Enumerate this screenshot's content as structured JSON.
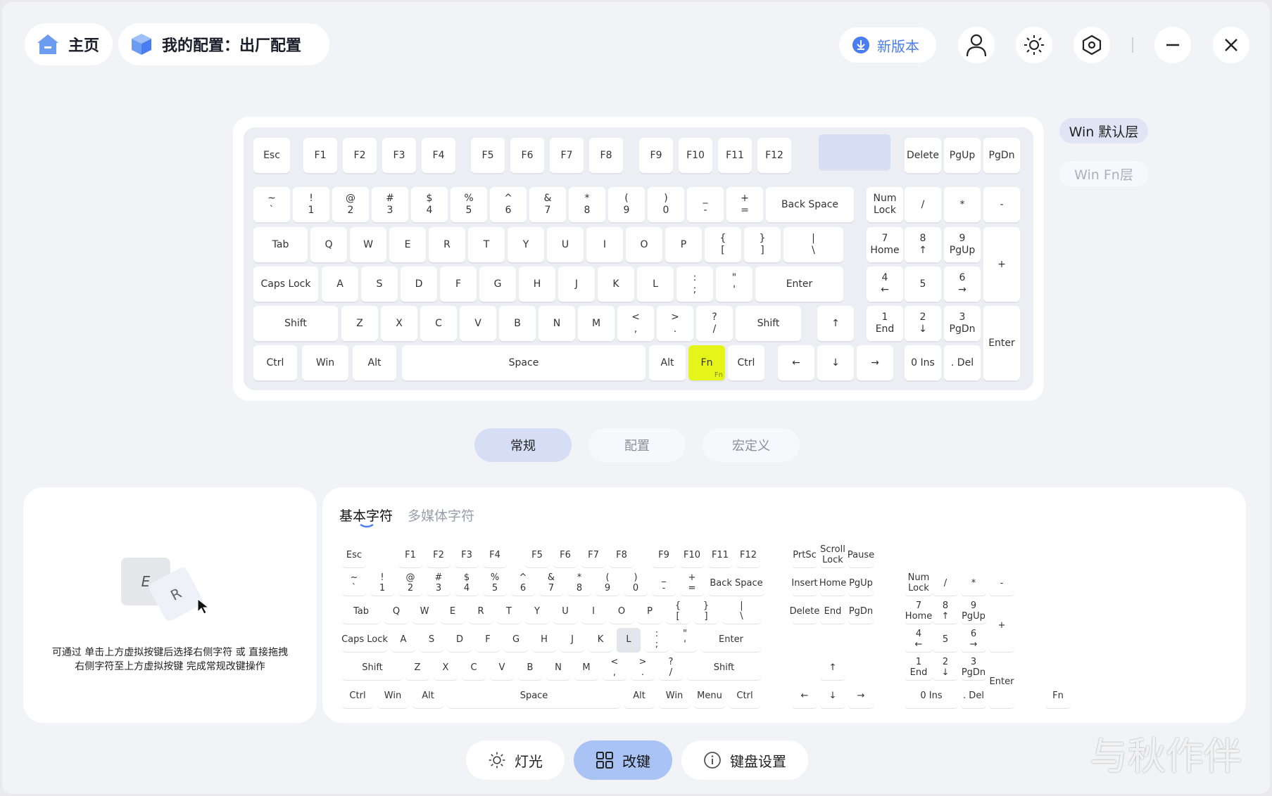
{
  "header": {
    "home_label": "主页",
    "config_label": "我的配置：出厂配置",
    "new_version_label": "新版本"
  },
  "layers": [
    "Win 默认层",
    "Win Fn层"
  ],
  "mode_tabs": [
    "常规",
    "配置",
    "宏定义"
  ],
  "left_panel": {
    "demo_key_1": "E",
    "demo_key_2": "R",
    "hint_line1": "可通过 单击上方虚拟按键后选择右侧字符 或 直接拖拽",
    "hint_line2": "右侧字符至上方虚拟按键 完成常规改键操作"
  },
  "char_tabs": [
    "基本字符",
    "多媒体字符"
  ],
  "bottom_tabs": [
    "灯光",
    "改键",
    "键盘设置"
  ],
  "watermark": "与秋作伴",
  "colors": {
    "accent": "#4a7df0",
    "selected_key": "#e5f51a",
    "active_tab_bg": "#d5def4"
  },
  "keyboard": [
    [
      "Esc"
    ],
    [
      "F1"
    ],
    [
      "F2"
    ],
    [
      "F3"
    ],
    [
      "F4"
    ],
    [
      "F5"
    ],
    [
      "F6"
    ],
    [
      "F7"
    ],
    [
      "F8"
    ],
    [
      "F9"
    ],
    [
      "F10"
    ],
    [
      "F11"
    ],
    [
      "F12"
    ],
    [
      ""
    ],
    [
      "Delete"
    ],
    [
      "PgUp"
    ],
    [
      "PgDn"
    ],
    [
      "~",
      "`"
    ],
    [
      "!",
      "1"
    ],
    [
      "@",
      "2"
    ],
    [
      "#",
      "3"
    ],
    [
      "$",
      "4"
    ],
    [
      "%",
      "5"
    ],
    [
      "^",
      "6"
    ],
    [
      "&",
      "7"
    ],
    [
      "*",
      "8"
    ],
    [
      "(",
      "9"
    ],
    [
      ")",
      "0"
    ],
    [
      "_",
      "-"
    ],
    [
      "+",
      "="
    ],
    [
      "Back Space"
    ],
    [
      "Num",
      "Lock"
    ],
    [
      "/"
    ],
    [
      "*"
    ],
    [
      "-"
    ],
    [
      "Tab"
    ],
    [
      "Q"
    ],
    [
      "W"
    ],
    [
      "E"
    ],
    [
      "R"
    ],
    [
      "T"
    ],
    [
      "Y"
    ],
    [
      "U"
    ],
    [
      "I"
    ],
    [
      "O"
    ],
    [
      "P"
    ],
    [
      "{",
      "["
    ],
    [
      "}",
      "]"
    ],
    [
      "|",
      "\\"
    ],
    [
      "7",
      "Home"
    ],
    [
      "8",
      "↑"
    ],
    [
      "9",
      "PgUp"
    ],
    [
      "+"
    ],
    [
      "Caps Lock"
    ],
    [
      "A"
    ],
    [
      "S"
    ],
    [
      "D"
    ],
    [
      "F"
    ],
    [
      "G"
    ],
    [
      "H"
    ],
    [
      "J"
    ],
    [
      "K"
    ],
    [
      "L"
    ],
    [
      ":",
      ";"
    ],
    [
      "\"",
      "'"
    ],
    [
      "Enter"
    ],
    [
      "4",
      "←"
    ],
    [
      "5"
    ],
    [
      "6",
      "→"
    ],
    [
      "Shift"
    ],
    [
      "Z"
    ],
    [
      "X"
    ],
    [
      "C"
    ],
    [
      "V"
    ],
    [
      "B"
    ],
    [
      "N"
    ],
    [
      "M"
    ],
    [
      "<",
      ","
    ],
    [
      ">",
      "."
    ],
    [
      "?",
      "/"
    ],
    [
      "Shift"
    ],
    [
      "↑"
    ],
    [
      "1",
      "End"
    ],
    [
      "2",
      "↓"
    ],
    [
      "3",
      "PgDn"
    ],
    [
      "Enter"
    ],
    [
      "Ctrl"
    ],
    [
      "Win"
    ],
    [
      "Alt"
    ],
    [
      "Space"
    ],
    [
      "Alt"
    ],
    [
      "Fn",
      "Fn"
    ],
    [
      "Ctrl"
    ],
    [
      "←"
    ],
    [
      "↓"
    ],
    [
      "→"
    ],
    [
      "0 Ins"
    ],
    [
      ". Del"
    ]
  ],
  "palette": [
    [
      "Esc"
    ],
    [
      "F1"
    ],
    [
      "F2"
    ],
    [
      "F3"
    ],
    [
      "F4"
    ],
    [
      "F5"
    ],
    [
      "F6"
    ],
    [
      "F7"
    ],
    [
      "F8"
    ],
    [
      "F9"
    ],
    [
      "F10"
    ],
    [
      "F11"
    ],
    [
      "F12"
    ],
    [
      "PrtSc"
    ],
    [
      "Scroll",
      "Lock"
    ],
    [
      "Pause"
    ],
    [
      "~",
      "`"
    ],
    [
      "!",
      "1"
    ],
    [
      "@",
      "2"
    ],
    [
      "#",
      "3"
    ],
    [
      "$",
      "4"
    ],
    [
      "%",
      "5"
    ],
    [
      "^",
      "6"
    ],
    [
      "&",
      "7"
    ],
    [
      "*",
      "8"
    ],
    [
      "(",
      "9"
    ],
    [
      ")",
      "0"
    ],
    [
      "_",
      "-"
    ],
    [
      "+",
      "="
    ],
    [
      "Back Space"
    ],
    [
      "Insert"
    ],
    [
      "Home"
    ],
    [
      "PgUp"
    ],
    [
      "Num",
      "Lock"
    ],
    [
      "/"
    ],
    [
      "*"
    ],
    [
      "-"
    ],
    [
      "Tab"
    ],
    [
      "Q"
    ],
    [
      "W"
    ],
    [
      "E"
    ],
    [
      "R"
    ],
    [
      "T"
    ],
    [
      "Y"
    ],
    [
      "U"
    ],
    [
      "I"
    ],
    [
      "O"
    ],
    [
      "P"
    ],
    [
      "{",
      "["
    ],
    [
      "}",
      "]"
    ],
    [
      "|",
      "\\"
    ],
    [
      "Delete"
    ],
    [
      "End"
    ],
    [
      "PgDn"
    ],
    [
      "7",
      "Home"
    ],
    [
      "8",
      "↑"
    ],
    [
      "9",
      "PgUp"
    ],
    [
      "+"
    ],
    [
      "Caps Lock"
    ],
    [
      "A"
    ],
    [
      "S"
    ],
    [
      "D"
    ],
    [
      "F"
    ],
    [
      "G"
    ],
    [
      "H"
    ],
    [
      "J"
    ],
    [
      "K"
    ],
    [
      "L"
    ],
    [
      ":",
      ";"
    ],
    [
      "\"",
      "'"
    ],
    [
      "Enter"
    ],
    [
      "4",
      "←"
    ],
    [
      "5"
    ],
    [
      "6",
      "→"
    ],
    [
      "Shift"
    ],
    [
      "Z"
    ],
    [
      "X"
    ],
    [
      "C"
    ],
    [
      "V"
    ],
    [
      "B"
    ],
    [
      "N"
    ],
    [
      "M"
    ],
    [
      "<",
      ","
    ],
    [
      ">",
      "."
    ],
    [
      "?",
      "/"
    ],
    [
      "Shift"
    ],
    [
      "↑"
    ],
    [
      "1",
      "End"
    ],
    [
      "2",
      "↓"
    ],
    [
      "3",
      "PgDn"
    ],
    [
      "Enter"
    ],
    [
      "Ctrl"
    ],
    [
      "Win"
    ],
    [
      "Alt"
    ],
    [
      "Space"
    ],
    [
      "Alt"
    ],
    [
      "Win"
    ],
    [
      "Menu"
    ],
    [
      "Ctrl"
    ],
    [
      "←"
    ],
    [
      "↓"
    ],
    [
      "→"
    ],
    [
      "0 Ins"
    ],
    [
      ". Del"
    ],
    [
      "Fn"
    ]
  ]
}
